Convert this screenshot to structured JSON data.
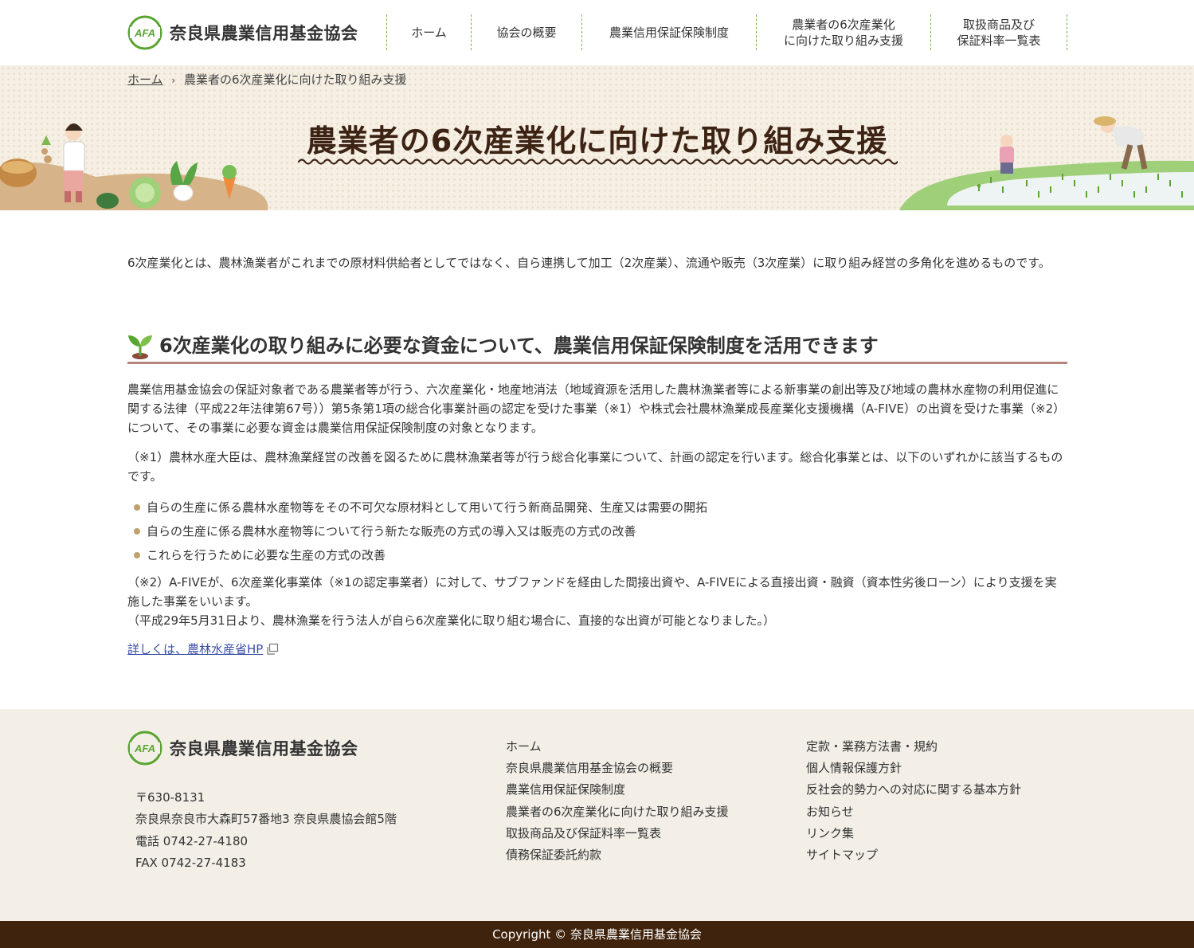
{
  "site": {
    "name": "奈良県農業信用基金協会",
    "logo_mark": "AFA"
  },
  "nav": {
    "items": [
      {
        "label": "ホーム"
      },
      {
        "label": "協会の概要"
      },
      {
        "label": "農業信用保証保険制度"
      },
      {
        "label": "農業者の6次産業化\nに向けた取り組み支援"
      },
      {
        "label": "取扱商品及び\n保証料率一覧表"
      }
    ]
  },
  "breadcrumb": {
    "home": "ホーム",
    "separator": "›",
    "current": "農業者の6次産業化に向けた取り組み支援"
  },
  "hero": {
    "title": "農業者の6次産業化に向けた取り組み支援"
  },
  "main": {
    "intro": "6次産業化とは、農林漁業者がこれまでの原材料供給者としてではなく、自ら連携して加工（2次産業）、流通や販売（3次産業）に取り組み経営の多角化を進めるものです。",
    "section_title": "6次産業化の取り組みに必要な資金について、農業信用保証保険制度を活用できます",
    "para1": "農業信用基金協会の保証対象者である農業者等が行う、六次産業化・地産地消法（地域資源を活用した農林漁業者等による新事業の創出等及び地域の農林水産物の利用促進に関する法律（平成22年法律第67号））第5条第1項の総合化事業計画の認定を受けた事業（※1）や株式会社農林漁業成長産業化支援機構（A-FIVE）の出資を受けた事業（※2）について、その事業に必要な資金は農業信用保証保険制度の対象となります。",
    "note1": "（※1）農林水産大臣は、農林漁業経営の改善を図るために農林漁業者等が行う総合化事業について、計画の認定を行います。総合化事業とは、以下のいずれかに該当するものです。",
    "bullets": [
      "自らの生産に係る農林水産物等をその不可欠な原材料として用いて行う新商品開発、生産又は需要の開拓",
      "自らの生産に係る農林水産物等について行う新たな販売の方式の導入又は販売の方式の改善",
      "これらを行うために必要な生産の方式の改善"
    ],
    "note2_line1": "（※2）A-FIVEが、6次産業化事業体（※1の認定事業者）に対して、サブファンドを経由した間接出資や、A-FIVEによる直接出資・融資（資本性劣後ローン）により支援を実施した事業をいいます。",
    "note2_line2": "（平成29年5月31日より、農林漁業を行う法人が自ら6次産業化に取り組む場合に、直接的な出資が可能となりました。）",
    "link_label": "詳しくは、農林水産省HP"
  },
  "footer": {
    "postal": "〒630-8131",
    "address": "奈良県奈良市大森町57番地3 奈良県農協会館5階",
    "tel": "電話 0742-27-4180",
    "fax": "FAX 0742-27-4183",
    "links_col1": [
      "ホーム",
      "奈良県農業信用基金協会の概要",
      "農業信用保証保険制度",
      "農業者の6次産業化に向けた取り組み支援",
      "取扱商品及び保証料率一覧表",
      "債務保証委託約款"
    ],
    "links_col2": [
      "定款・業務方法書・規約",
      "個人情報保護方針",
      "反社会的勢力への対応に関する基本方針",
      "お知らせ",
      "リンク集",
      "サイトマップ"
    ],
    "copyright": "Copyright © 奈良県農業信用基金協会"
  },
  "colors": {
    "brand_green": "#5aa532",
    "title_brown": "#3d2313",
    "footer_bar": "#3f230d",
    "heading_rule": "#b5867b",
    "link_blue": "#3a4fa6"
  },
  "icons": {
    "logo": "afa-logo-icon",
    "section": "sprout-icon",
    "external": "external-link-icon"
  }
}
